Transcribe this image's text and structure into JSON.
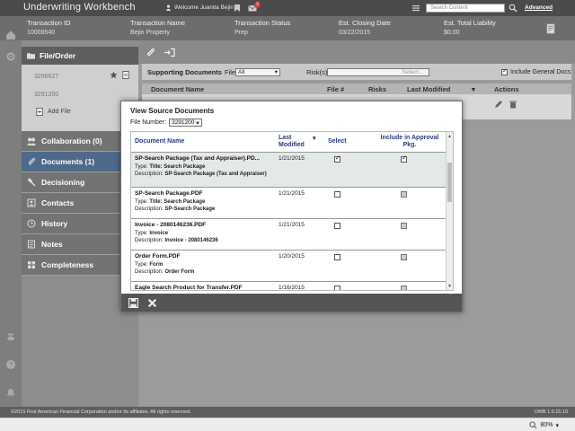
{
  "app": {
    "title": "Underwriting Workbench",
    "welcome": "Welcome Juanita Bejin",
    "notification_count": "3",
    "search_placeholder": "Search Content",
    "advanced_label": "Advanced"
  },
  "info": {
    "transaction_id_label": "Transaction ID",
    "transaction_id": "10008540",
    "transaction_name_label": "Transaction Name",
    "transaction_name": "Bejin Property",
    "status_label": "Transaction Status",
    "status": "Prep",
    "closing_label": "Est. Closing Date",
    "closing": "03/22/2015",
    "liability_label": "Est. Total Liability",
    "liability": "$0.00"
  },
  "sidebar": {
    "file_order_label": "File/Order",
    "files": [
      "3296627",
      "3291200"
    ],
    "add_file_label": "Add File",
    "items": [
      {
        "label": "Collaboration (0)",
        "icon": "collaboration-icon"
      },
      {
        "label": "Documents (1)",
        "icon": "paperclip-icon"
      },
      {
        "label": "Decisioning",
        "icon": "gavel-icon"
      },
      {
        "label": "Contacts",
        "icon": "contacts-icon"
      },
      {
        "label": "History",
        "icon": "clock-icon"
      },
      {
        "label": "Notes",
        "icon": "notes-icon"
      },
      {
        "label": "Completeness",
        "icon": "grid-icon"
      }
    ]
  },
  "documents_panel": {
    "supporting_label": "Supporting Documents",
    "file_label": "File",
    "file_value": "All",
    "risks_label": "Risk(s)",
    "risks_placeholder": "Select...",
    "include_general_label": "Include General Docs",
    "columns": [
      "Document Name",
      "File #",
      "Risks",
      "Last Modified",
      "Actions"
    ]
  },
  "modal": {
    "title": "View Source Documents",
    "file_number_label": "File Number:",
    "file_number_value": "3291200",
    "columns": {
      "name": "Document Name",
      "last_modified": "Last Modified",
      "select": "Select",
      "include": "Include in Approval Pkg."
    },
    "type_label": "Type:",
    "description_label": "Description:",
    "rows": [
      {
        "name": "SP-Search Package (Tax and Appraiser).PD...",
        "type": "Title: Search Package",
        "description": "SP-Search Package (Tax and Appraiser)",
        "date": "1/21/2015",
        "select": true,
        "include": true
      },
      {
        "name": "SP-Search Package.PDF",
        "type": "Title: Search Package",
        "description": "SP-Search Package",
        "date": "1/21/2015",
        "select": false,
        "include": false
      },
      {
        "name": "Invoice - 2080146236.PDF",
        "type": "Invoice",
        "description": "Invoice - 2080146236",
        "date": "1/21/2015",
        "select": false,
        "include": false
      },
      {
        "name": "Order Form.PDF",
        "type": "Form",
        "description": "Order Form",
        "date": "1/20/2015",
        "select": false,
        "include": false
      },
      {
        "name": "Eagle Search Product for Transfer.PDF",
        "type": "",
        "description": "",
        "date": "1/16/2015",
        "select": false,
        "include": false
      }
    ]
  },
  "footer": {
    "copyright": "©2015 First American Financial Corporation and/or its affiliates. All rights reserved.",
    "version": "UWB 1.0.15.10",
    "zoom": "80%"
  }
}
